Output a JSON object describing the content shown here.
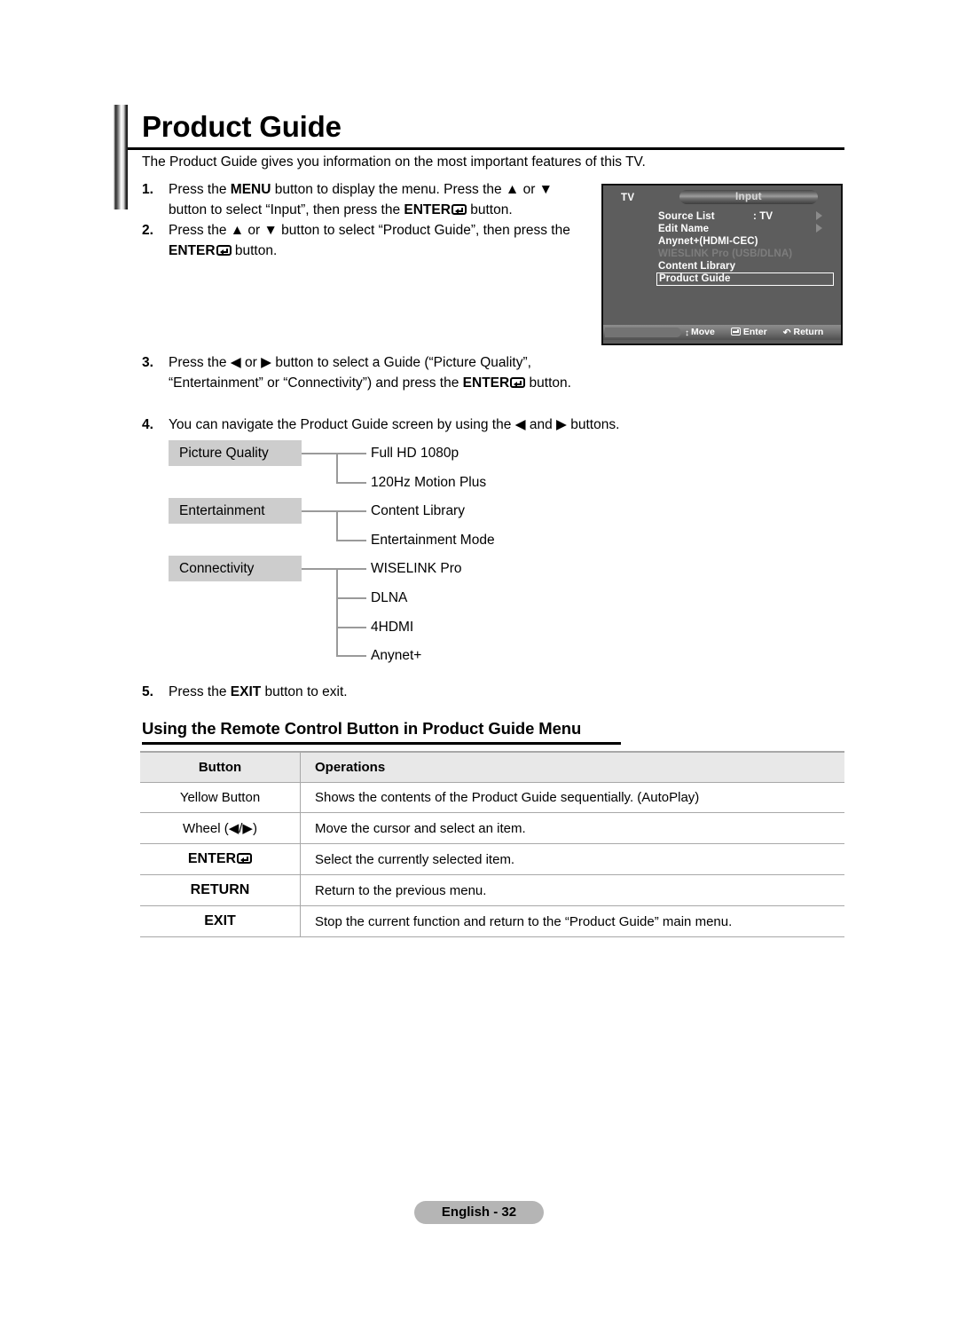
{
  "page": {
    "title": "Product Guide",
    "intro": "The Product Guide gives you information on the most important features of this TV."
  },
  "steps": [
    {
      "num": "1.",
      "parts": [
        "Press the ",
        "MENU",
        " button to display the menu. Press the ▲ or ▼ button to select “Input”, then press the ",
        "ENTER",
        " button."
      ]
    },
    {
      "num": "2.",
      "parts": [
        "Press the ▲ or ▼ button to select “Product Guide”, then press the ",
        "ENTER",
        " button."
      ]
    },
    {
      "num": "3.",
      "parts": [
        "Press the ◀ or ▶ button to select a Guide (“Picture Quality”, “Entertainment” or “Connectivity”) and press the ",
        "ENTER",
        " button."
      ]
    },
    {
      "num": "4.",
      "parts": [
        "You can navigate the Product Guide screen by using the ◀ and ▶ buttons."
      ]
    },
    {
      "num": "5.",
      "parts": [
        "Press the ",
        "EXIT",
        " button to exit."
      ]
    }
  ],
  "step_text": {
    "s1a": "Press the ",
    "s1b": "MENU",
    "s1c": " button to display the menu. Press the ▲ or ▼ button to select “Input”, then press the ",
    "s1d": "ENTER",
    "s1e": " button.",
    "s2a": "Press the ▲ or ▼ button to select “Product Guide”, then press the ",
    "s2b": "ENTER",
    "s2c": " button.",
    "s3a": "Press the ◀ or ▶ button to select a Guide (“Picture Quality”, “Entertainment” or “Connectivity”) and press the ",
    "s3b": "ENTER",
    "s3c": " button.",
    "s4a": "You can navigate the Product Guide screen by using the ◀ and ▶ buttons.",
    "s5a": "Press the ",
    "s5b": "EXIT",
    "s5c": " button to exit."
  },
  "osd": {
    "source_label": "TV",
    "menu_title": "Input",
    "items": [
      {
        "label": "Source List",
        "value": ": TV",
        "arrow": true,
        "disabled": false,
        "selected": false
      },
      {
        "label": "Edit Name",
        "value": "",
        "arrow": true,
        "disabled": false,
        "selected": false
      },
      {
        "label": "Anynet+(HDMI-CEC)",
        "value": "",
        "arrow": false,
        "disabled": false,
        "selected": false
      },
      {
        "label": "WIESLINK Pro (USB/DLNA)",
        "value": "",
        "arrow": false,
        "disabled": true,
        "selected": false
      },
      {
        "label": "Content Library",
        "value": "",
        "arrow": false,
        "disabled": false,
        "selected": false
      },
      {
        "label": "Product Guide",
        "value": "",
        "arrow": false,
        "disabled": false,
        "selected": true
      }
    ],
    "footer": {
      "move": "Move",
      "enter": "Enter",
      "return": "Return",
      "move_icon": "up-down-arrow-icon",
      "enter_icon": "enter-key-icon",
      "return_icon": "return-arrow-icon"
    }
  },
  "tree": {
    "branches": [
      {
        "name": "Picture Quality",
        "leaves": [
          "Full HD 1080p",
          "120Hz Motion Plus"
        ]
      },
      {
        "name": "Entertainment",
        "leaves": [
          "Content Library",
          "Entertainment Mode"
        ]
      },
      {
        "name": "Connectivity",
        "leaves": [
          "WISELINK Pro",
          "DLNA",
          "4HDMI",
          "Anynet+"
        ]
      }
    ]
  },
  "section": {
    "heading": "Using the Remote Control Button in Product Guide Menu"
  },
  "table": {
    "headers": [
      "Button",
      "Operations"
    ],
    "rows": [
      {
        "button": "Yellow Button",
        "bold": false,
        "enter_glyph": false,
        "operation": "Shows the contents of the Product Guide sequentially. (AutoPlay)"
      },
      {
        "button": "Wheel (◀/▶)",
        "bold": false,
        "enter_glyph": false,
        "operation": "Move the cursor and select an item."
      },
      {
        "button": "ENTER",
        "bold": true,
        "enter_glyph": true,
        "operation": "Select the currently selected item."
      },
      {
        "button": "RETURN",
        "bold": true,
        "enter_glyph": false,
        "operation": "Return to the previous menu."
      },
      {
        "button": "EXIT",
        "bold": true,
        "enter_glyph": false,
        "operation": "Stop the current function and return to the “Product Guide” main menu."
      }
    ]
  },
  "footer": {
    "badge": "English - 32"
  },
  "colors": {
    "node_fill": "#cdcdcd",
    "table_header": "#e8e8e8",
    "rule": "#a8a8a8",
    "osd_bg": "#5d5d5d",
    "badge": "#b5b5b5"
  }
}
